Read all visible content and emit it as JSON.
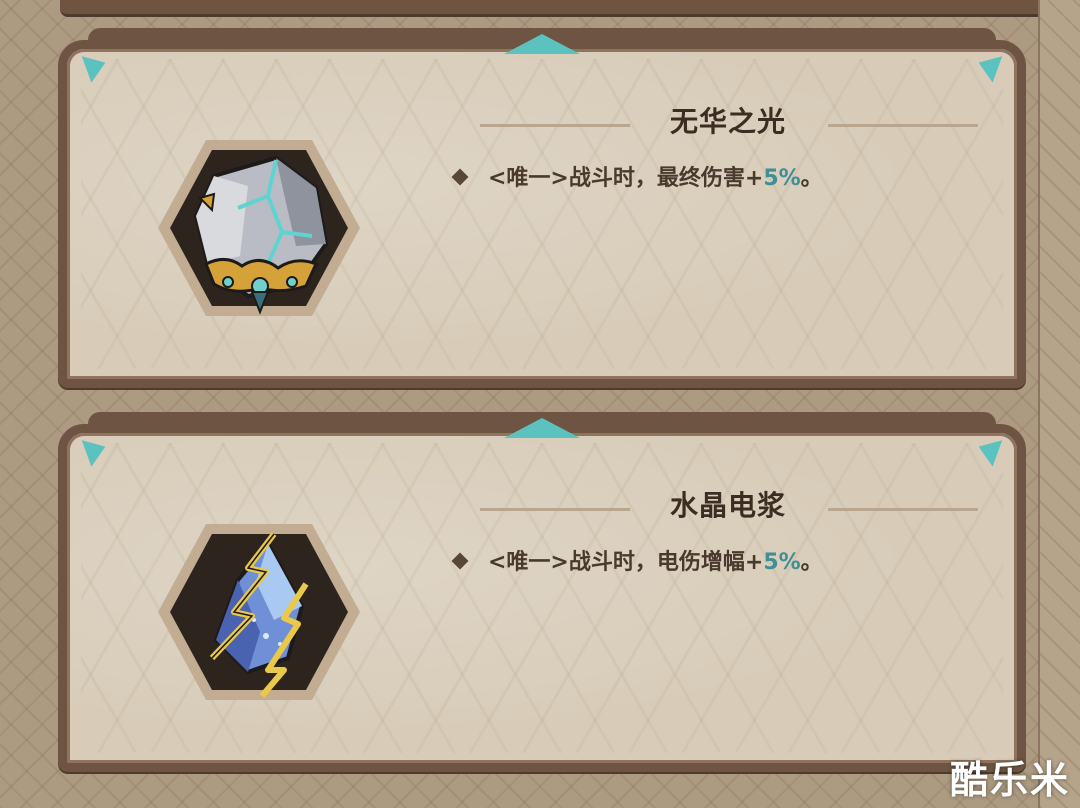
{
  "items": [
    {
      "name": "无华之光",
      "tag": "<唯一>",
      "effect": "战斗时，最终伤害+",
      "value": "5%",
      "suffix": "。",
      "icon": "gray-stone-relic-icon"
    },
    {
      "name": "水晶电浆",
      "tag": "<唯一>",
      "effect": "战斗时，电伤增幅+",
      "value": "5%",
      "suffix": "。",
      "icon": "lightning-crystal-relic-icon"
    }
  ],
  "watermark": "酷乐米",
  "colors": {
    "frame": "#6e5442",
    "panel": "#d8ccb9",
    "accent_gem": "#5cc2c0",
    "value_text": "#3f8f94",
    "title_text": "#3b2d22"
  }
}
